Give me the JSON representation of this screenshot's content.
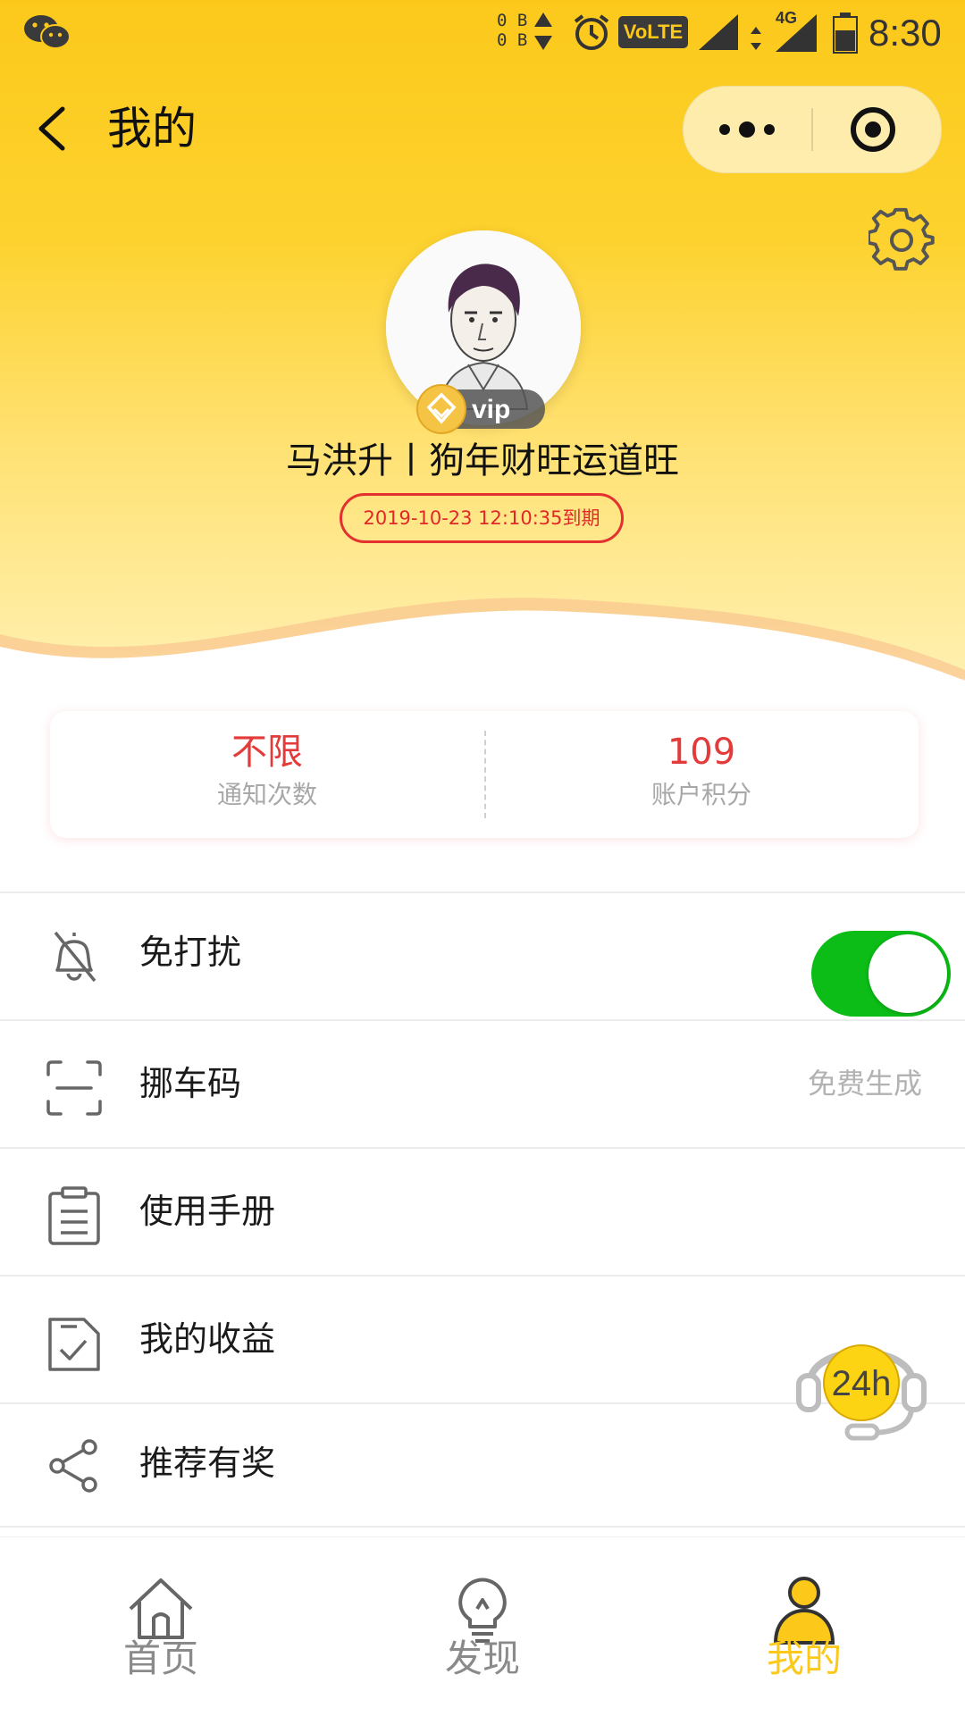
{
  "status_bar": {
    "net_up": "0 B",
    "net_down": "0 B",
    "volte": "VoLTE",
    "network": "4G",
    "time": "8:30"
  },
  "nav": {
    "title": "我的",
    "back_icon": "chevron-left-icon",
    "more_icon": "more-dots-icon",
    "close_icon": "target-close-icon"
  },
  "profile": {
    "username": "马洪升丨狗年财旺运道旺",
    "vip_label": "vip",
    "expiry": "2019-10-23 12:10:35到期"
  },
  "stats": [
    {
      "value": "不限",
      "label": "通知次数"
    },
    {
      "value": "109",
      "label": "账户积分"
    }
  ],
  "menu": [
    {
      "label": "免打扰",
      "icon": "bell-off-icon",
      "toggle_on": true
    },
    {
      "label": "挪车码",
      "icon": "scan-icon",
      "right_text": "免费生成"
    },
    {
      "label": "使用手册",
      "icon": "clipboard-icon"
    },
    {
      "label": "我的收益",
      "icon": "checklist-icon"
    },
    {
      "label": "推荐有奖",
      "icon": "share-icon"
    }
  ],
  "support": {
    "label": "24h",
    "icon": "headset-icon"
  },
  "tabbar": [
    {
      "label": "首页",
      "icon": "home-icon",
      "active": false
    },
    {
      "label": "发现",
      "icon": "lightbulb-icon",
      "active": false
    },
    {
      "label": "我的",
      "icon": "user-icon",
      "active": true
    }
  ],
  "colors": {
    "brand_yellow": "#fcc91b",
    "accent_red": "#e33a3a",
    "toggle_green": "#0bbd16",
    "muted_text": "#a8a8a8"
  }
}
